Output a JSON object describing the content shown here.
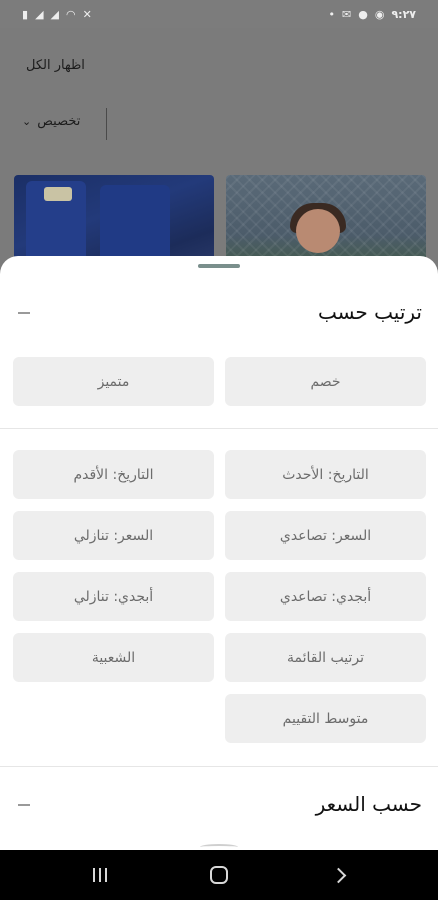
{
  "status_bar": {
    "time": "٩:٢٧",
    "left_icons": [
      "battery-icon",
      "signal-icon",
      "signal-icon",
      "wifi-icon",
      "mute-icon"
    ],
    "right_icons": [
      "whatsapp-icon",
      "facebook-icon",
      "gmail-icon",
      "dot-icon"
    ]
  },
  "background_page": {
    "show_all": "اظهار الكل",
    "customize": "تخصيص"
  },
  "sheet": {
    "sort_title": "ترتيب حسب",
    "tag_options": [
      "خصم",
      "متميز"
    ],
    "sort_options": [
      [
        "التاريخ: الأحدث",
        "التاريخ: الأقدم"
      ],
      [
        "السعر: تصاعدي",
        "السعر: تنازلي"
      ],
      [
        "أبجدي: تصاعدي",
        "أبجدي: تنازلي"
      ],
      [
        "ترتيب القائمة",
        "الشعبية"
      ],
      [
        "متوسط التقييم"
      ]
    ],
    "price_title": "حسب السعر"
  }
}
